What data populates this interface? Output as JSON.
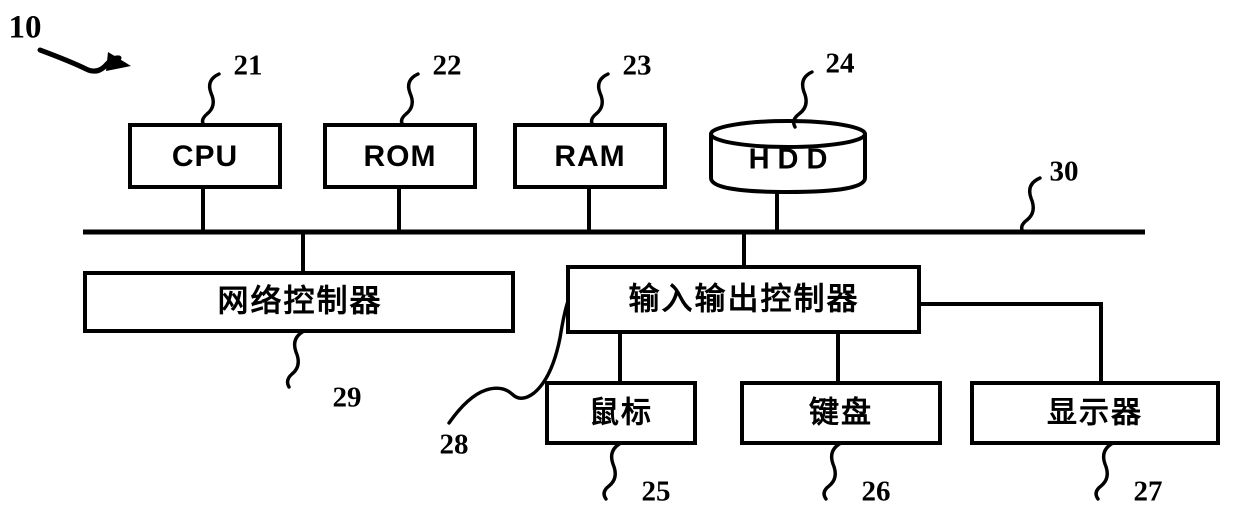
{
  "figure": {
    "title_ref": "10",
    "bus_ref": "30"
  },
  "blocks": {
    "cpu": {
      "label": "CPU",
      "ref": "21"
    },
    "rom": {
      "label": "ROM",
      "ref": "22"
    },
    "ram": {
      "label": "RAM",
      "ref": "23"
    },
    "hdd": {
      "label": "HDD",
      "ref": "24"
    },
    "network_controller": {
      "label": "网络控制器",
      "ref": "29"
    },
    "io_controller": {
      "label": "输入输出控制器",
      "ref": "28"
    },
    "mouse": {
      "label": "鼠标",
      "ref": "25"
    },
    "keyboard": {
      "label": "键盘",
      "ref": "26"
    },
    "display": {
      "label": "显示器",
      "ref": "27"
    }
  },
  "colors": {
    "line": "#000000",
    "fill": "#ffffff"
  }
}
